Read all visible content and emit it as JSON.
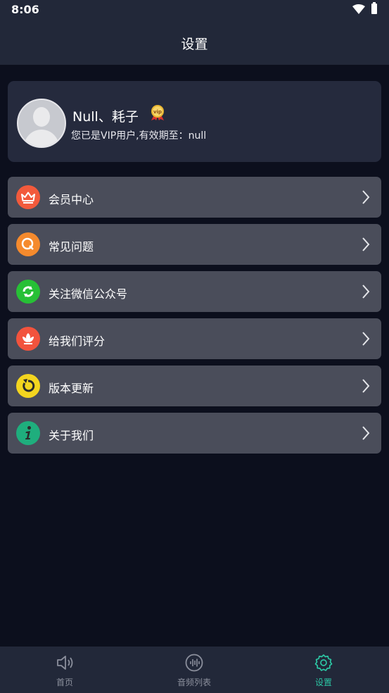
{
  "status_bar": {
    "time": "8:06"
  },
  "header": {
    "title": "设置"
  },
  "profile": {
    "name": "Null、耗子",
    "subtitle": "您已是VIP用户,有效期至：null",
    "vip_badge_icon": "vip-medal-icon"
  },
  "menu": [
    {
      "label": "会员中心",
      "icon": "crown-icon",
      "color": "#f25a3c"
    },
    {
      "label": "常见问题",
      "icon": "question-q-icon",
      "color": "#f58a2d"
    },
    {
      "label": "关注微信公众号",
      "icon": "wechat-official-account-icon",
      "color": "#27c036"
    },
    {
      "label": "给我们评分",
      "icon": "rate-flower-icon",
      "color": "#f2533d"
    },
    {
      "label": "版本更新",
      "icon": "update-refresh-icon",
      "color": "#f3d51f"
    },
    {
      "label": "关于我们",
      "icon": "info-icon",
      "color": "#1fae7d"
    }
  ],
  "tab_bar": {
    "tabs": [
      {
        "label": "首页",
        "icon": "speaker-icon",
        "active": false
      },
      {
        "label": "音频列表",
        "icon": "audio-wave-icon",
        "active": false
      },
      {
        "label": "设置",
        "icon": "gear-icon",
        "active": true
      }
    ],
    "active_color": "#2cc6a4"
  }
}
